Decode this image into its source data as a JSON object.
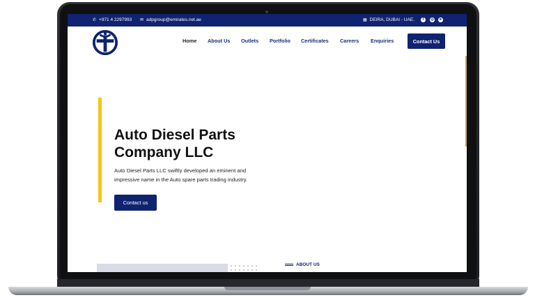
{
  "topbar": {
    "phone": "+971 4 2297993",
    "email": "adpgroup@emirates.net.ae",
    "location": "DEIRA, DUBAI - UAE.",
    "socials": [
      "facebook-icon",
      "instagram-icon",
      "telegram-icon"
    ]
  },
  "nav": {
    "items": [
      "Home",
      "About Us",
      "Outlets",
      "Portfolio",
      "Certificates",
      "Careers",
      "Enquiries"
    ],
    "contact_button": "Contact Us"
  },
  "hero": {
    "title": "Auto Diesel Parts Company LLC",
    "description": "Auto Diesel Parts LLC swiftly developed an eminent and impressive name in the Auto spare parts trading industry.",
    "button": "Contact us"
  },
  "about": {
    "label": "ABOUT US"
  },
  "colors": {
    "brand": "#0f2370",
    "accent": "#f5c518"
  }
}
